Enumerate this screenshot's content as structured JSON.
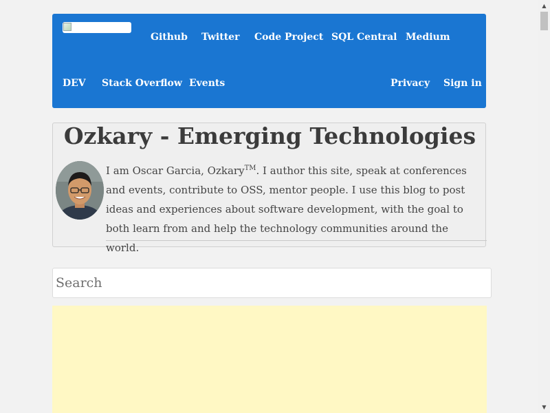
{
  "nav": {
    "logo_alt": "",
    "links_row1": [
      "Github",
      "Twitter",
      "Code Project",
      "SQL Central",
      "Medium"
    ],
    "links_row2_left": [
      "DEV",
      "Stack Overflow",
      "Events"
    ],
    "links_row2_right": [
      "Privacy",
      "Sign in"
    ]
  },
  "header": {
    "title": "Ozkary - Emerging Technologies",
    "bio_before_tm": "I am Oscar Garcia, Ozkary",
    "bio_tm": "TM",
    "bio_after_tm": ". I author this site, speak at conferences and events, contribute to OSS, mentor people. I use this blog to post ideas and experiences about software development, with the goal to both learn from and help the technology communities around the world.",
    "avatar_icon": "person-photo-icon"
  },
  "search": {
    "placeholder": "Search",
    "value": ""
  },
  "colors": {
    "nav_bg": "#1a76d2",
    "page_bg": "#f2f2f2",
    "content_block_bg": "#fff8c4",
    "title_text": "#3b3b3b"
  }
}
